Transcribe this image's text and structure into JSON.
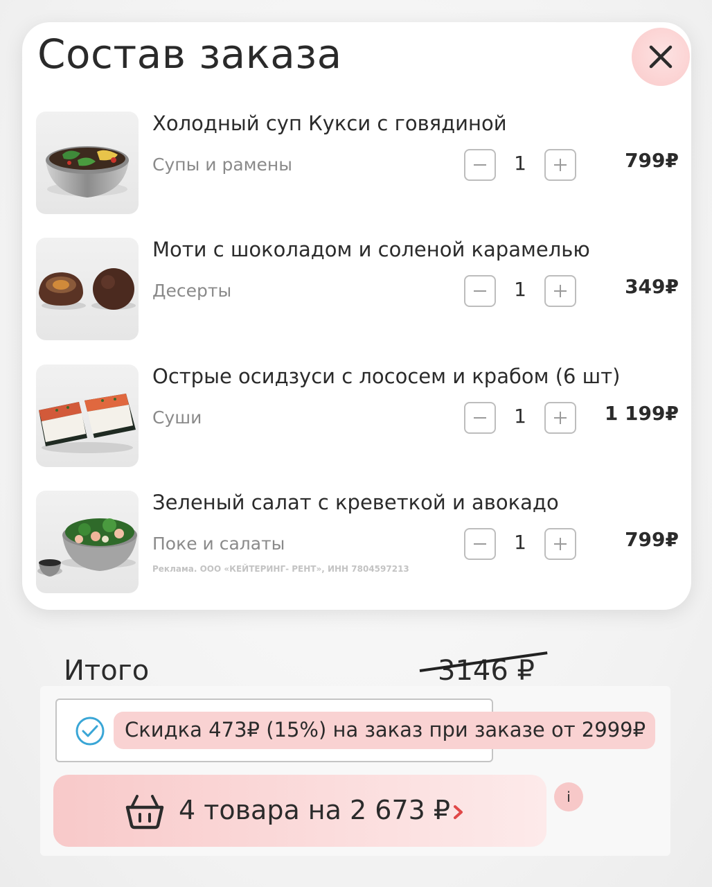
{
  "order": {
    "title": "Состав заказа",
    "items": [
      {
        "name": "Холодный суп Кукси с говядиной",
        "category": "Супы и рамены",
        "qty": "1",
        "price": "799₽",
        "image": "bowl-noodle-soup"
      },
      {
        "name": "Моти с шоколадом и соленой карамелью",
        "category": "Десерты",
        "qty": "1",
        "price": "349₽",
        "image": "chocolate-mochi"
      },
      {
        "name": "Острые осидзуси с лососем и крабом (6 шт)",
        "category": "Суши",
        "qty": "1",
        "price": "1 199₽",
        "image": "oshizushi"
      },
      {
        "name": "Зеленый салат с креветкой и авокадо",
        "category": "Поке и салаты",
        "qty": "1",
        "price": "799₽",
        "image": "green-salad-bowl"
      }
    ],
    "ad_note": "Реклама. ООО «КЕЙТЕРИНГ- РЕНТ», ИНН 7804597213"
  },
  "summary": {
    "total_label": "Итого",
    "old_total": "3146 ₽",
    "discount_text": "Скидка 473₽ (15%) на заказ при заказе от 2999₽",
    "checkout_text": "4 товара на 2 673 ₽",
    "info_label": "i"
  },
  "colors": {
    "accent_pink": "#f9d2d2",
    "check_blue": "#3aa6d6",
    "chevron_red": "#e04848"
  }
}
